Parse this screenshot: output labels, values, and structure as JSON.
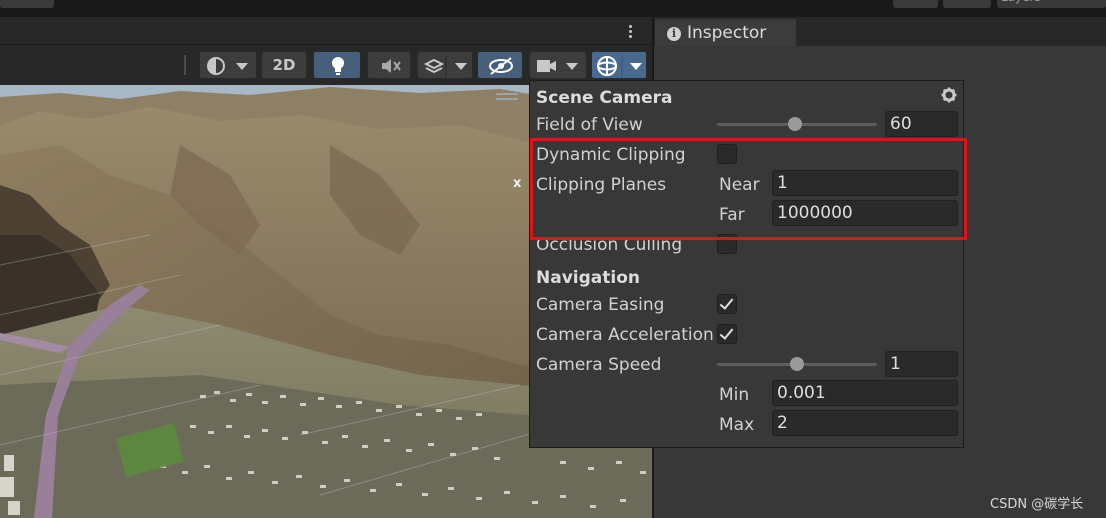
{
  "topbar": {
    "layers_label": "Layers"
  },
  "inspector": {
    "tab_label": "Inspector"
  },
  "toolbar": {
    "mode_2d_label": "2D"
  },
  "scene_camera": {
    "title": "Scene Camera",
    "field_of_view": {
      "label": "Field of View",
      "value": "60",
      "slider_fraction": 0.47
    },
    "dynamic_clipping": {
      "label": "Dynamic Clipping",
      "checked": false
    },
    "clipping_planes": {
      "label": "Clipping Planes",
      "near_label": "Near",
      "near_value": "1",
      "far_label": "Far",
      "far_value": "1000000"
    },
    "occlusion_culling": {
      "label": "Occlusion Culling",
      "checked": false
    },
    "navigation_header": "Navigation",
    "camera_easing": {
      "label": "Camera Easing",
      "checked": true
    },
    "camera_acceleration": {
      "label": "Camera Acceleration",
      "checked": true
    },
    "camera_speed": {
      "label": "Camera Speed",
      "value": "1",
      "slider_fraction": 0.5,
      "min_label": "Min",
      "min_value": "0.001",
      "max_label": "Max",
      "max_value": "2"
    }
  },
  "viewport": {
    "close_marker": "x"
  },
  "watermark": "CSDN @碳学长",
  "colors": {
    "highlight": "#e0131b",
    "panel": "#383838",
    "active_button": "#46607c"
  }
}
